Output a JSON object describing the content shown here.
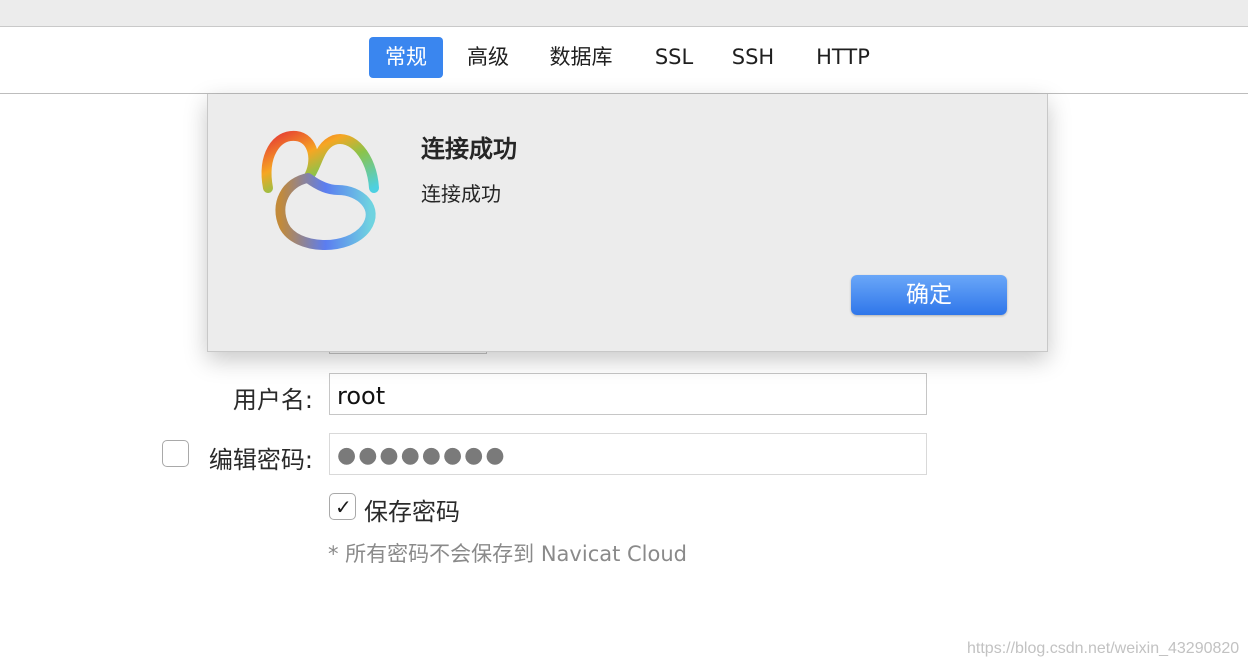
{
  "tabs": [
    {
      "label": "常规",
      "active": true
    },
    {
      "label": "高级",
      "active": false
    },
    {
      "label": "数据库",
      "active": false
    },
    {
      "label": "SSL",
      "active": false
    },
    {
      "label": "SSH",
      "active": false
    },
    {
      "label": "HTTP",
      "active": false
    }
  ],
  "form": {
    "username_label": "用户名:",
    "username_value": "root",
    "edit_password_label": "编辑密码:",
    "edit_password_checked": false,
    "password_value": "●●●●●●●●",
    "save_password_label": "保存密码",
    "save_password_checked": true,
    "note": "* 所有密码不会保存到 Navicat Cloud"
  },
  "alert": {
    "title": "连接成功",
    "message": "连接成功",
    "ok_label": "确定",
    "icon": "navicat-logo-icon"
  },
  "colors": {
    "accent": "#3a86ef",
    "sheet_bg": "#ececec"
  },
  "watermark": "https://blog.csdn.net/weixin_43290820"
}
